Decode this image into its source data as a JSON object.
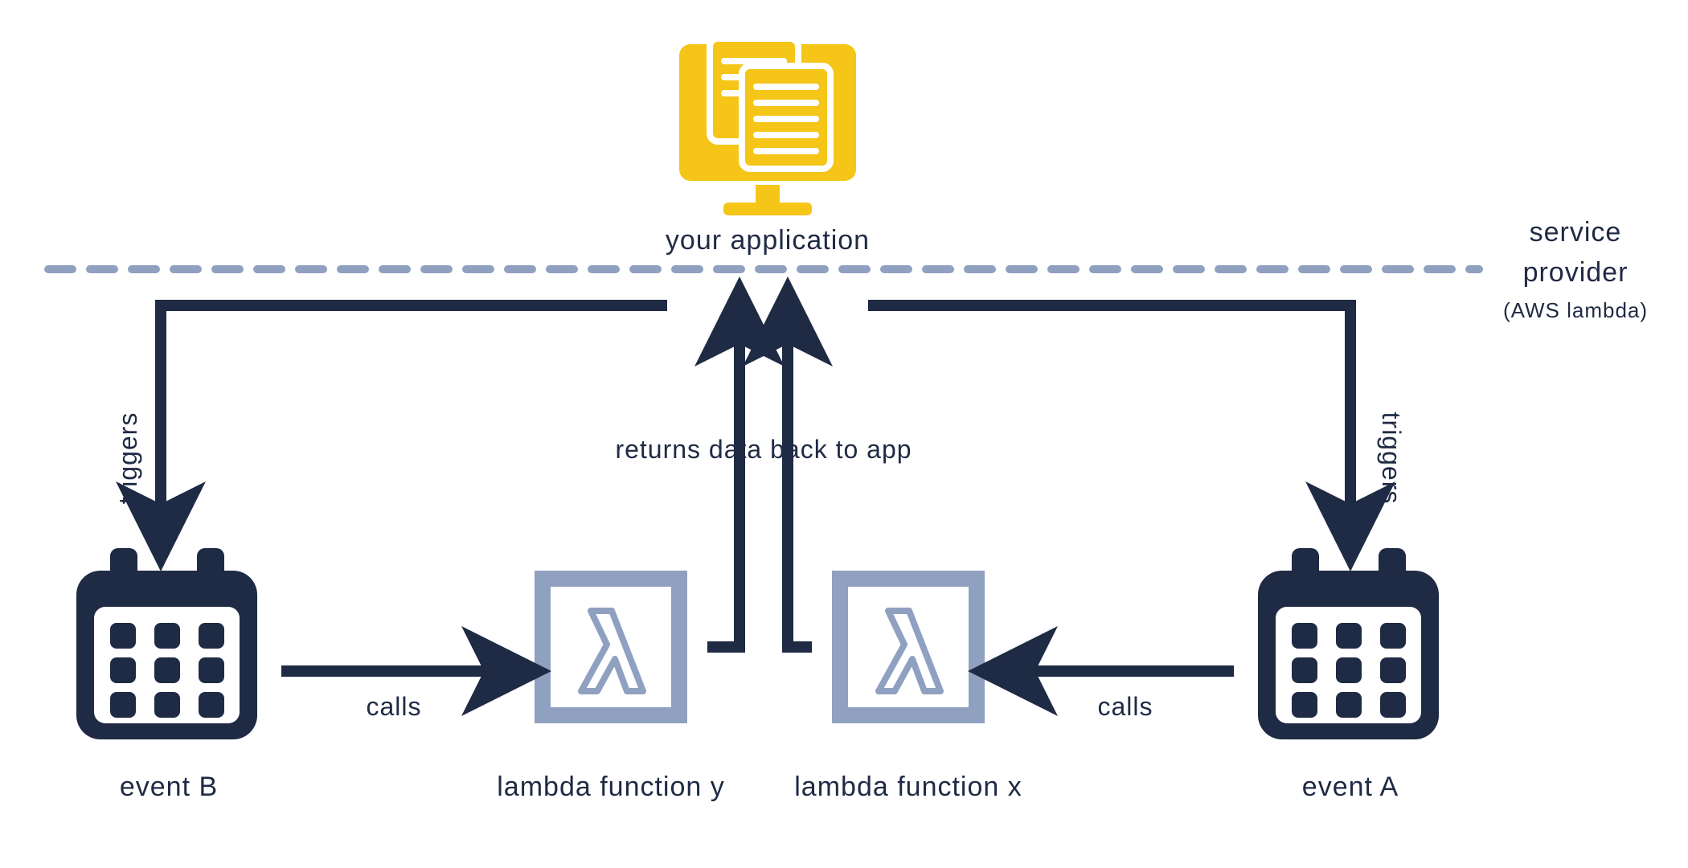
{
  "colors": {
    "navy": "#1f2a44",
    "steel": "#90a0c0",
    "yellow": "#f5c518",
    "white": "#ffffff"
  },
  "nodes": {
    "app": {
      "label": "your application"
    },
    "eventA": {
      "label": "event A"
    },
    "eventB": {
      "label": "event B"
    },
    "lambdaX": {
      "label": "lambda function x"
    },
    "lambdaY": {
      "label": "lambda function y"
    }
  },
  "edges": {
    "triggersLeft": {
      "label": "triggers"
    },
    "triggersRight": {
      "label": "triggers"
    },
    "callsLeft": {
      "label": "calls"
    },
    "callsRight": {
      "label": "calls"
    },
    "returns": {
      "label": "returns data back to app"
    }
  },
  "boundary": {
    "line1": "service",
    "line2": "provider",
    "line3": "(AWS lambda)"
  }
}
